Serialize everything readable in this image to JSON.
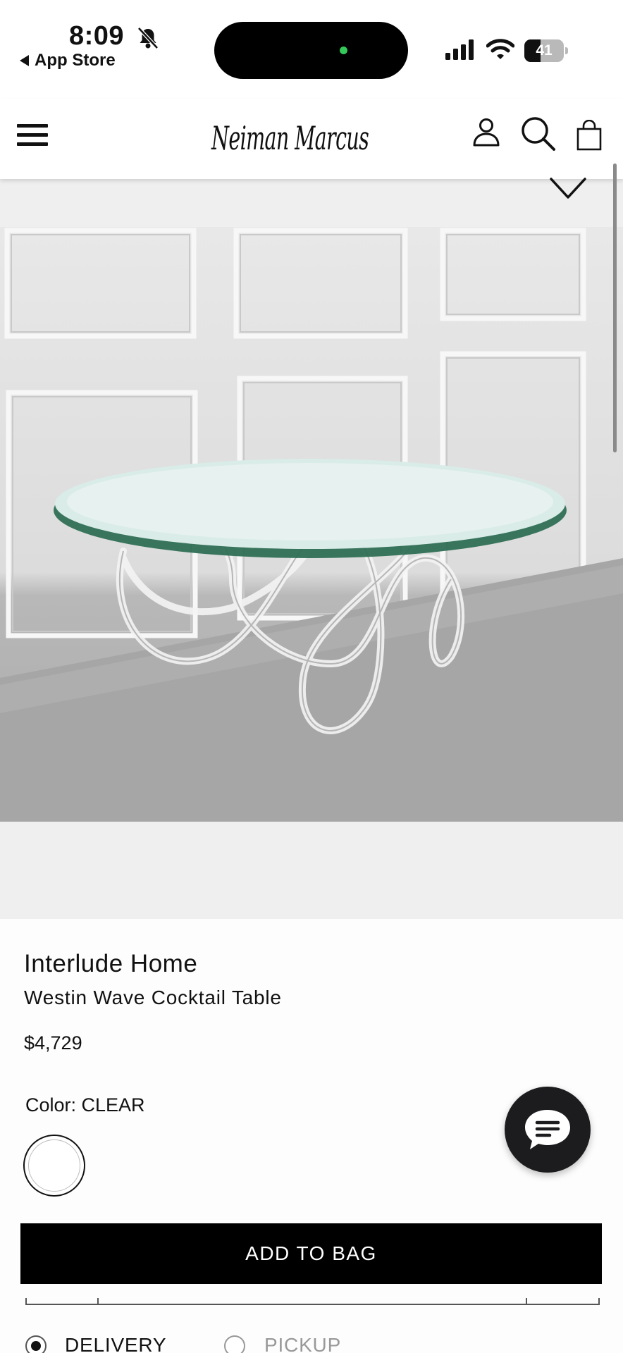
{
  "status_bar": {
    "time": "8:09",
    "back_label": "App Store",
    "battery": "41",
    "battery_level": 0.41
  },
  "header": {
    "logo": "Neiman Marcus"
  },
  "product": {
    "brand": "Interlude Home",
    "name": "Westin Wave Cocktail Table",
    "price": "$4,729",
    "color_label": "Color: CLEAR",
    "add_to_bag": "ADD TO BAG"
  },
  "fulfillment": {
    "options": [
      "DELIVERY",
      "PICKUP"
    ],
    "selected": "DELIVERY"
  },
  "colors": {
    "accent": "#000000",
    "chat_button": "#1c1c1e",
    "island_dot": "#34c759"
  }
}
